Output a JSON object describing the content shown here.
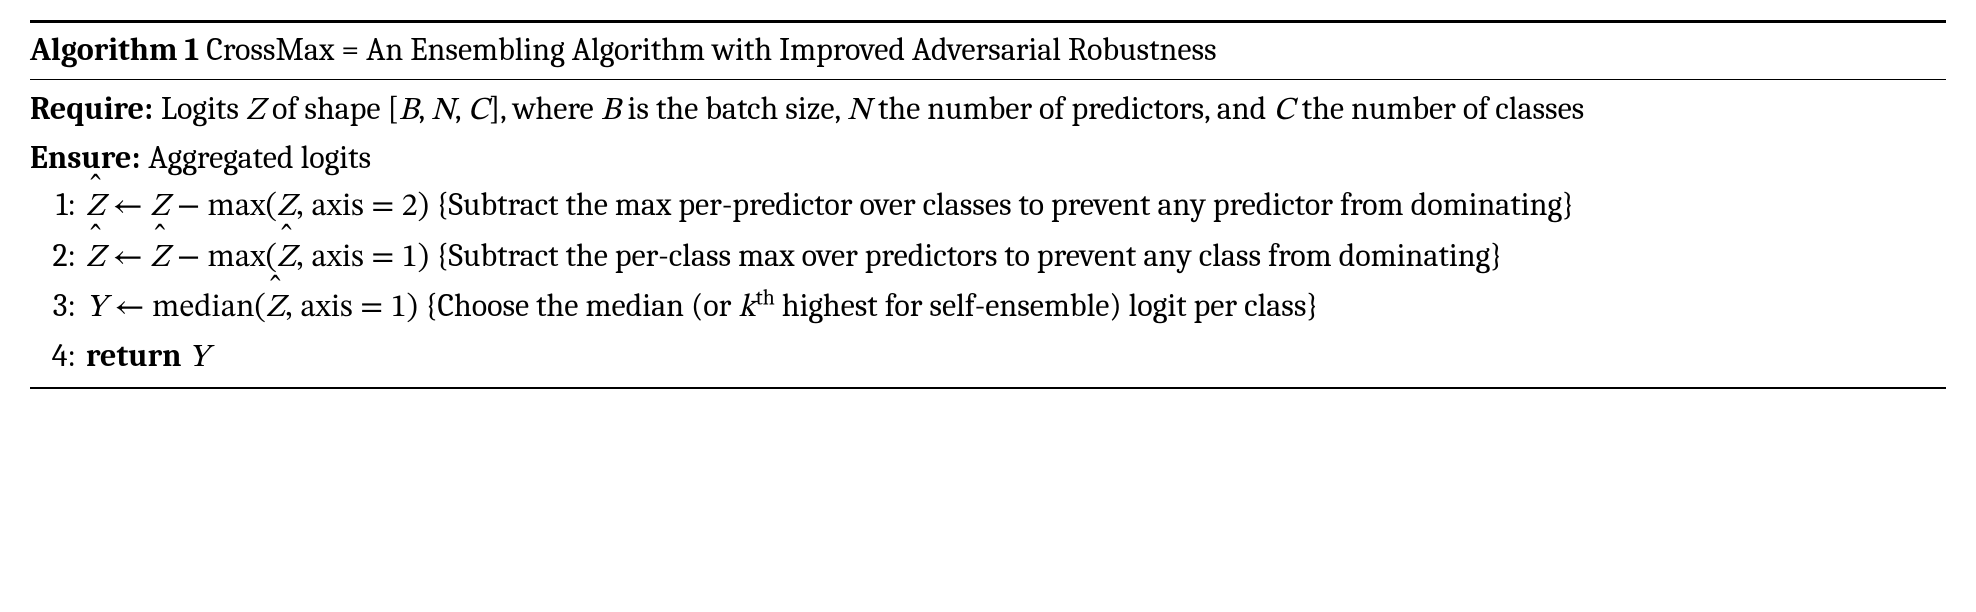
{
  "algorithm": {
    "label": "Algorithm 1",
    "title": " CrossMax = An Ensembling Algorithm with Improved Adversarial Robustness",
    "require_kw": "Require:",
    "require_text_1": " Logits ",
    "require_var_Z": "Z",
    "require_text_2": " of shape [",
    "require_var_B": "B",
    "require_text_3": ", ",
    "require_var_N": "N",
    "require_text_4": ", ",
    "require_var_C": "C",
    "require_text_5": "], where ",
    "require_var_B2": "B",
    "require_text_6": " is the batch size, ",
    "require_var_N2": "N",
    "require_text_7": " the number of predictors, and ",
    "require_var_C2": "C",
    "require_text_8": " the number of classes",
    "ensure_kw": "Ensure:",
    "ensure_text": " Aggregated logits",
    "steps": {
      "s1": {
        "num": "1:",
        "lhs": "Z",
        "arrow": " ← ",
        "rhs_a": "Z",
        "rhs_b": " − max(",
        "rhs_c": "Z",
        "rhs_d": ", axis = 2)",
        "comment": " {Subtract the max per-predictor over classes to prevent any predictor from dominating}"
      },
      "s2": {
        "num": "2:",
        "lhs": "Z",
        "arrow": " ← ",
        "rhs_a": "Z",
        "rhs_b": " − max(",
        "rhs_c": "Z",
        "rhs_d": ", axis = 1)",
        "comment": " {Subtract the per-class max over predictors to prevent any class from dominating}"
      },
      "s3": {
        "num": "3:",
        "lhs": "Y",
        "arrow": " ← ",
        "rhs_a": "median(",
        "rhs_b": "Z",
        "rhs_c": ", axis = 1)",
        "comment_a": " {Choose the median (or ",
        "comment_k": "k",
        "comment_sup": "th",
        "comment_b": " highest for self-ensemble) logit per class}"
      },
      "s4": {
        "num": "4:",
        "kw": "return ",
        "var": "Y"
      }
    }
  }
}
